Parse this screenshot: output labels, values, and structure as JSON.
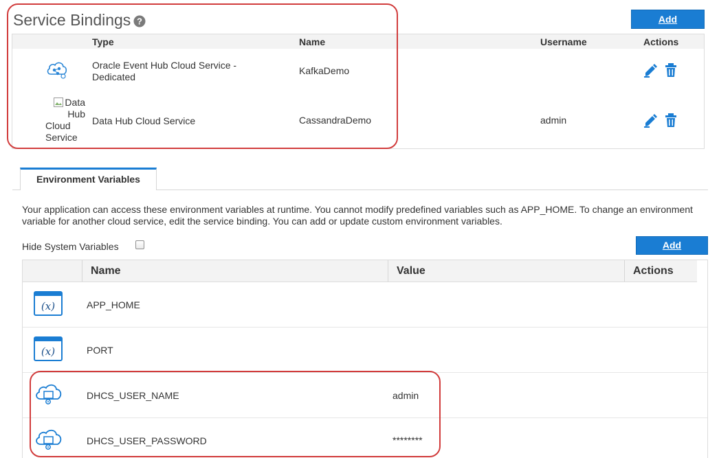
{
  "service_bindings": {
    "title": "Service Bindings",
    "add_label": "Add",
    "columns": {
      "type": "Type",
      "name": "Name",
      "username": "Username",
      "actions": "Actions"
    },
    "rows": [
      {
        "type_line1": "Oracle Event Hub Cloud Service -",
        "type_line2": "Dedicated",
        "name": "KafkaDemo",
        "username": "",
        "icon": "event-hub-cloud-icon"
      },
      {
        "type_line1": "Data Hub Cloud Service",
        "type_line2": "",
        "name": "CassandraDemo",
        "username": "admin",
        "icon": "broken-image-icon",
        "image_alt": [
          "Data",
          "Hub",
          "Cloud",
          "Service"
        ]
      }
    ]
  },
  "tabs": [
    {
      "label": "Environment Variables",
      "active": true
    }
  ],
  "environment": {
    "description": "Your application can access these environment variables at runtime. You cannot modify predefined variables such as APP_HOME. To change an environment variable for another cloud service, edit the service binding. You can add or update custom environment variables.",
    "hide_system_label": "Hide System Variables",
    "hide_system_checked": false,
    "add_label": "Add",
    "columns": {
      "name": "Name",
      "value": "Value",
      "actions": "Actions"
    },
    "rows": [
      {
        "name": "APP_HOME",
        "value": "",
        "icon": "variable-icon"
      },
      {
        "name": "PORT",
        "value": "",
        "icon": "variable-icon"
      },
      {
        "name": "DHCS_USER_NAME",
        "value": "admin",
        "icon": "cloud-service-icon"
      },
      {
        "name": "DHCS_USER_PASSWORD",
        "value": "********",
        "icon": "cloud-service-icon"
      }
    ]
  },
  "colors": {
    "accent": "#1a7dd3",
    "annotation": "#d13b3b",
    "header_bg": "#f3f3f3"
  }
}
